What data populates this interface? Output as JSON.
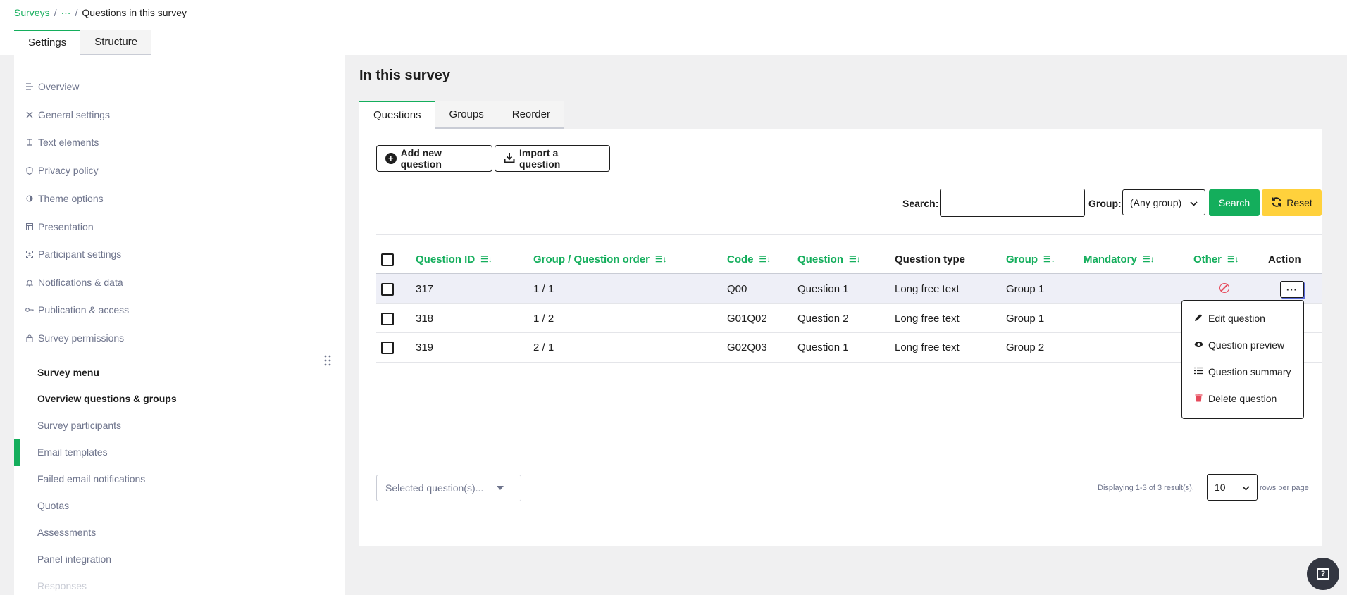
{
  "breadcrumb": {
    "root": "Surveys",
    "ellipsis": "···",
    "separator": "/",
    "current": "Questions in this survey"
  },
  "top_tabs": [
    {
      "label": "Settings"
    },
    {
      "label": "Structure"
    }
  ],
  "sidebar": {
    "items": [
      {
        "label": "Overview",
        "icon": "list-icon"
      },
      {
        "label": "General settings",
        "icon": "tools-icon"
      },
      {
        "label": "Text elements",
        "icon": "text-icon"
      },
      {
        "label": "Privacy policy",
        "icon": "shield-icon"
      },
      {
        "label": "Theme options",
        "icon": "contrast-icon"
      },
      {
        "label": "Presentation",
        "icon": "layout-icon"
      },
      {
        "label": "Participant settings",
        "icon": "participant-icon"
      },
      {
        "label": "Notifications & data",
        "icon": "bell-icon"
      },
      {
        "label": "Publication & access",
        "icon": "key-icon"
      },
      {
        "label": "Survey permissions",
        "icon": "lock-icon"
      }
    ],
    "menu_heading": "Survey menu",
    "menu_items": [
      {
        "label": "Overview questions & groups"
      },
      {
        "label": "Survey participants"
      },
      {
        "label": "Email templates"
      },
      {
        "label": "Failed email notifications"
      },
      {
        "label": "Quotas"
      },
      {
        "label": "Assessments"
      },
      {
        "label": "Panel integration"
      },
      {
        "label": "Responses"
      }
    ]
  },
  "main": {
    "title": "In this survey",
    "tabs": [
      {
        "label": "Questions"
      },
      {
        "label": "Groups"
      },
      {
        "label": "Reorder"
      }
    ],
    "buttons": {
      "add_question": "Add new question",
      "import_question": "Import a question"
    },
    "filter": {
      "search_label": "Search:",
      "search_value": "",
      "group_label": "Group:",
      "group_value": "(Any group)",
      "search_button": "Search",
      "reset_button": "Reset"
    },
    "table": {
      "columns": [
        {
          "label": "Question ID",
          "sortable": true
        },
        {
          "label": "Group / Question order",
          "sortable": true
        },
        {
          "label": "Code",
          "sortable": true
        },
        {
          "label": "Question",
          "sortable": true
        },
        {
          "label": "Question type",
          "sortable": false
        },
        {
          "label": "Group",
          "sortable": true
        },
        {
          "label": "Mandatory",
          "sortable": true
        },
        {
          "label": "Other",
          "sortable": true
        },
        {
          "label": "Action",
          "sortable": false
        }
      ],
      "rows": [
        {
          "id": "317",
          "order": "1 / 1",
          "code": "Q00",
          "question": "Question 1",
          "type": "Long free text",
          "group": "Group 1"
        },
        {
          "id": "318",
          "order": "1 / 2",
          "code": "G01Q02",
          "question": "Question 2",
          "type": "Long free text",
          "group": "Group 1"
        },
        {
          "id": "319",
          "order": "2 / 1",
          "code": "G02Q03",
          "question": "Question 1",
          "type": "Long free text",
          "group": "Group 2"
        }
      ]
    },
    "action_button": "···",
    "action_menu": [
      {
        "label": "Edit question",
        "icon": "pencil-icon"
      },
      {
        "label": "Question preview",
        "icon": "eye-icon"
      },
      {
        "label": "Question summary",
        "icon": "list-icon"
      },
      {
        "label": "Delete question",
        "icon": "trash-icon"
      }
    ],
    "bulk_select": "Selected question(s)...",
    "pager": {
      "summary": "Displaying 1-3 of 3 result(s).",
      "rows_value": "10",
      "rows_suffix": "rows per page"
    }
  },
  "colors": {
    "accent": "#14ae5c",
    "reset": "#ffd13c",
    "danger": "#e64a5b",
    "row_highlight": "#eeeff7"
  }
}
